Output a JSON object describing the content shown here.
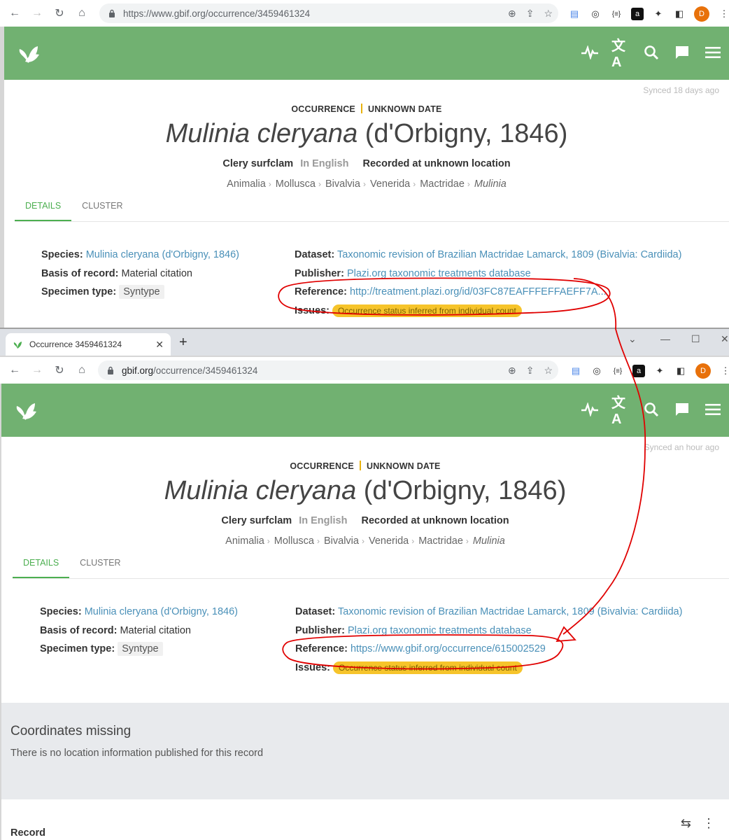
{
  "screens": {
    "top": {
      "url": "https://www.gbif.org/occurrence/3459461324",
      "synced": "Synced 18 days ago",
      "reference_value": "http://treatment.plazi.org/id/03FC87EAFFFEFFAEFF7A..."
    },
    "bottom": {
      "tab_title": "Occurrence 3459461324",
      "url_host": "gbif.org",
      "url_path": "/occurrence/3459461324",
      "synced": "Synced an hour ago",
      "reference_value": "https://www.gbif.org/occurrence/615002529"
    }
  },
  "record": {
    "kicker_left": "OCCURRENCE",
    "kicker_right": "UNKNOWN DATE",
    "sci_name_italic": "Mulinia cleryana",
    "sci_author": "(d'Orbigny, 1846)",
    "common_name": "Clery surfclam",
    "language": "In English",
    "location": "Recorded at unknown location",
    "taxonomy": [
      "Animalia",
      "Mollusca",
      "Bivalvia",
      "Venerida",
      "Mactridae"
    ],
    "genus": "Mulinia",
    "tabs": [
      "DETAILS",
      "CLUSTER"
    ],
    "labels": {
      "species": "Species:",
      "basis": "Basis of record:",
      "specimen": "Specimen type:",
      "dataset": "Dataset:",
      "publisher": "Publisher:",
      "reference": "Reference:",
      "issues": "Issues:"
    },
    "species_value": "Mulinia cleryana (d'Orbigny, 1846)",
    "basis_value": "Material citation",
    "specimen_value": "Syntype",
    "dataset_value": "Taxonomic revision of Brazilian Mactridae Lamarck, 1809 (Bivalvia: Cardiida)",
    "publisher_value": "Plazi.org taxonomic treatments database",
    "issue_value": "Occurrence status inferred from individual count"
  },
  "coordinates": {
    "title": "Coordinates missing",
    "text": "There is no location information published for this record"
  },
  "record_section": {
    "title": "Record"
  },
  "avatar_letter": "D",
  "colors": {
    "gbif_green": "#71b171",
    "accent_green": "#4caf50",
    "link": "#4a90b8",
    "issue": "#f6c42b",
    "annotation": "#e00000"
  }
}
